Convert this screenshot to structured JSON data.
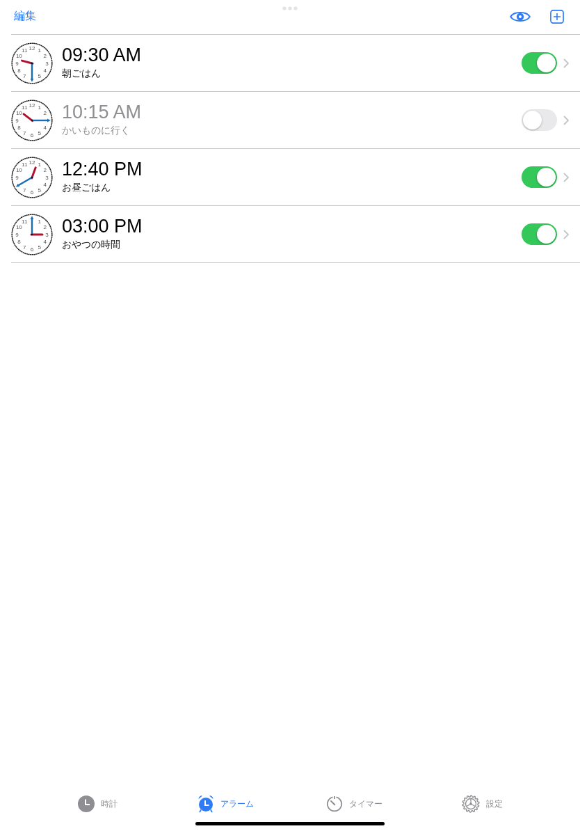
{
  "nav": {
    "edit": "編集"
  },
  "alarms": [
    {
      "time": "09:30 AM",
      "label": "朝ごはん",
      "on": true,
      "dial": [
        "11",
        "12",
        "1",
        "10",
        "2",
        "9",
        "3",
        "8",
        "4",
        "7",
        "5"
      ]
    },
    {
      "time": "10:15 AM",
      "label": "かいものに行く",
      "on": false,
      "dial": [
        "11",
        "12",
        "1",
        "10",
        "2",
        "9",
        "8",
        "4",
        "7",
        "6",
        "5"
      ]
    },
    {
      "time": "12:40 PM",
      "label": "お昼ごはん",
      "on": true,
      "dial": [
        "11",
        "12",
        "1",
        "10",
        "2",
        "9",
        "3",
        "4",
        "7",
        "6",
        "5"
      ]
    },
    {
      "time": "03:00 PM",
      "label": "おやつの時間",
      "on": true,
      "dial": [
        "11",
        "1",
        "10",
        "2",
        "9",
        "3",
        "8",
        "4",
        "7",
        "6",
        "5"
      ]
    }
  ],
  "tabs": [
    {
      "label": "時計",
      "selected": false
    },
    {
      "label": "アラーム",
      "selected": true
    },
    {
      "label": "タイマー",
      "selected": false
    },
    {
      "label": "設定",
      "selected": false
    }
  ]
}
